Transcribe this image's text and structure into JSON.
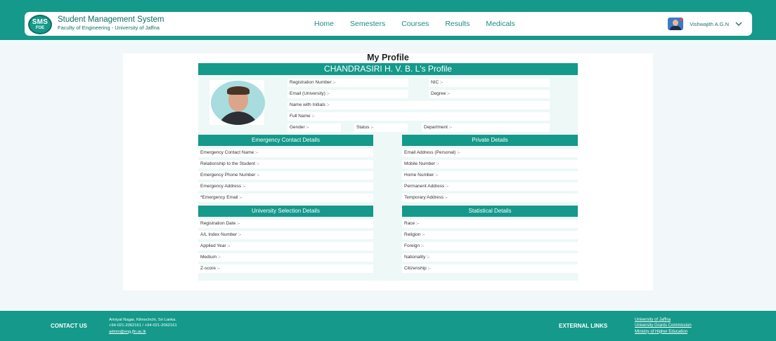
{
  "header": {
    "logo_top": "SMS",
    "logo_bottom": "FOE",
    "title": "Student Management System",
    "subtitle": "Faculty of Engineering - University of Jaffna",
    "nav": [
      "Home",
      "Semesters",
      "Courses",
      "Results",
      "Medicals"
    ],
    "user_name": "Vishwajith A.G.N",
    "user_icon": "chevron-down-icon"
  },
  "page": {
    "title": "My Profile",
    "profile_header": "CHANDRASIRI H. V. B. L's Profile"
  },
  "basic": {
    "registration_number": "Registration Number :-",
    "nic": "NIC :-",
    "email_university": "Email (University) :-",
    "degree": "Degree :-",
    "name_with_initials": "Name with Initials :-",
    "full_name": "Full Name :-",
    "gender": "Gender :-",
    "status": "Status :-",
    "department": "Department :-"
  },
  "emergency": {
    "heading": "Emergency Contact Details",
    "fields": [
      "Emergency Contact Name :-",
      "Relationship to the Student :-",
      "Emergency Phone Number :-",
      "Emergency Address :-",
      "*Emergency Email :-"
    ]
  },
  "private": {
    "heading": "Private Details",
    "fields": [
      "Email Address (Personal) :-",
      "Mobile Number :-",
      "Home Number :-",
      "Permanent Address :-",
      "Temporary Address :-"
    ]
  },
  "selection": {
    "heading": "University Selection Details",
    "fields": [
      "Registration Date :-",
      "A/L Index Number :-",
      "Applied Year :-",
      "Medium :-",
      "Z-score :-"
    ]
  },
  "statistical": {
    "heading": "Statistical Details",
    "fields": [
      "Race :-",
      "Religion :-",
      "Foreign :-",
      "Nationality :-",
      "Citizenship :-"
    ]
  },
  "footer": {
    "contact_title": "CONTACT US",
    "address": "Ariviyal Nagar, Kilinochchi, Sri Lanka.",
    "phone": "+94-021-2062161 / +94-021-2062161",
    "email": "admin@eng.jfn.ac.lk",
    "external_title": "EXTERNAL LINKS",
    "links": [
      "University of Jaffna",
      "University Grants Commission",
      "Ministry of Higher Education"
    ]
  },
  "colors": {
    "primary": "#14998a",
    "background": "#f2f7f9",
    "panel": "#edf8f7"
  }
}
